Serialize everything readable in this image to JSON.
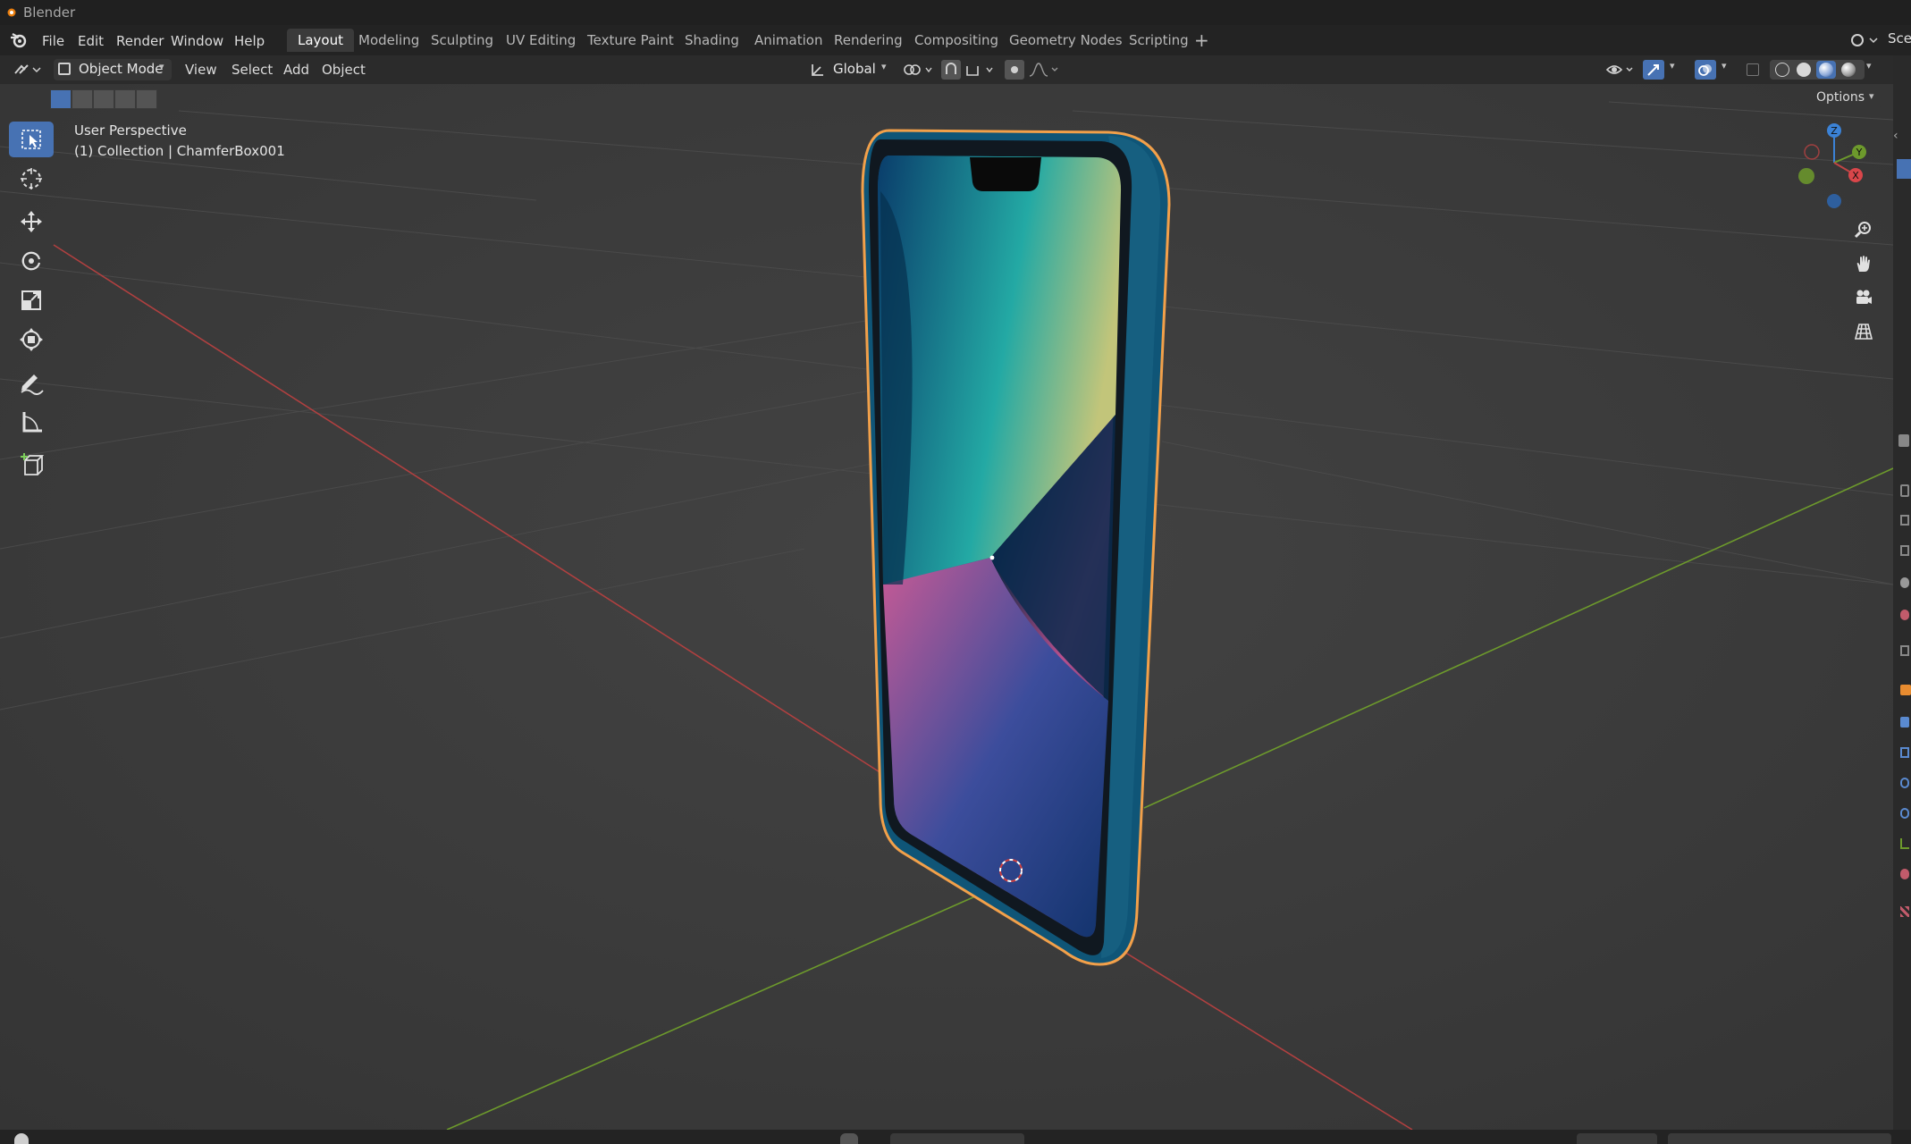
{
  "app": {
    "title": "Blender"
  },
  "menus": [
    "File",
    "Edit",
    "Render",
    "Window",
    "Help"
  ],
  "workspaces": [
    "Layout",
    "Modeling",
    "Sculpting",
    "UV Editing",
    "Texture Paint",
    "Shading",
    "Animation",
    "Rendering",
    "Compositing",
    "Geometry Nodes",
    "Scripting"
  ],
  "active_workspace": "Layout",
  "scene_label": "Sce",
  "header": {
    "mode": "Object Mode",
    "view": "View",
    "select": "Select",
    "add": "Add",
    "object": "Object",
    "orientation": "Global",
    "options": "Options"
  },
  "viewport": {
    "perspective": "User Perspective",
    "collection_info": "(1) Collection | ChamferBox001"
  },
  "gizmo": {
    "x": "X",
    "y": "Y",
    "z": "Z"
  },
  "colors": {
    "accent": "#4772b3",
    "selection_outline": "#f2a04a",
    "x_axis": "#c04545",
    "y_axis": "#6d9a2c",
    "z_axis": "#3b82d6"
  },
  "tools": [
    "select-box",
    "cursor",
    "move",
    "rotate",
    "scale",
    "transform",
    "annotate",
    "measure",
    "add-cube"
  ],
  "icons": [
    "blender-logo",
    "editor-type-icon",
    "object-mode-icon",
    "orientation-icon",
    "pivot-icon",
    "snap-icon",
    "proportional-icon",
    "visibility-icon",
    "gizmo-icon",
    "overlay-icon",
    "xray-icon",
    "wireframe-icon",
    "solid-icon",
    "material-icon",
    "rendered-icon",
    "zoom-icon",
    "hand-icon",
    "camera-icon",
    "grid-icon"
  ]
}
